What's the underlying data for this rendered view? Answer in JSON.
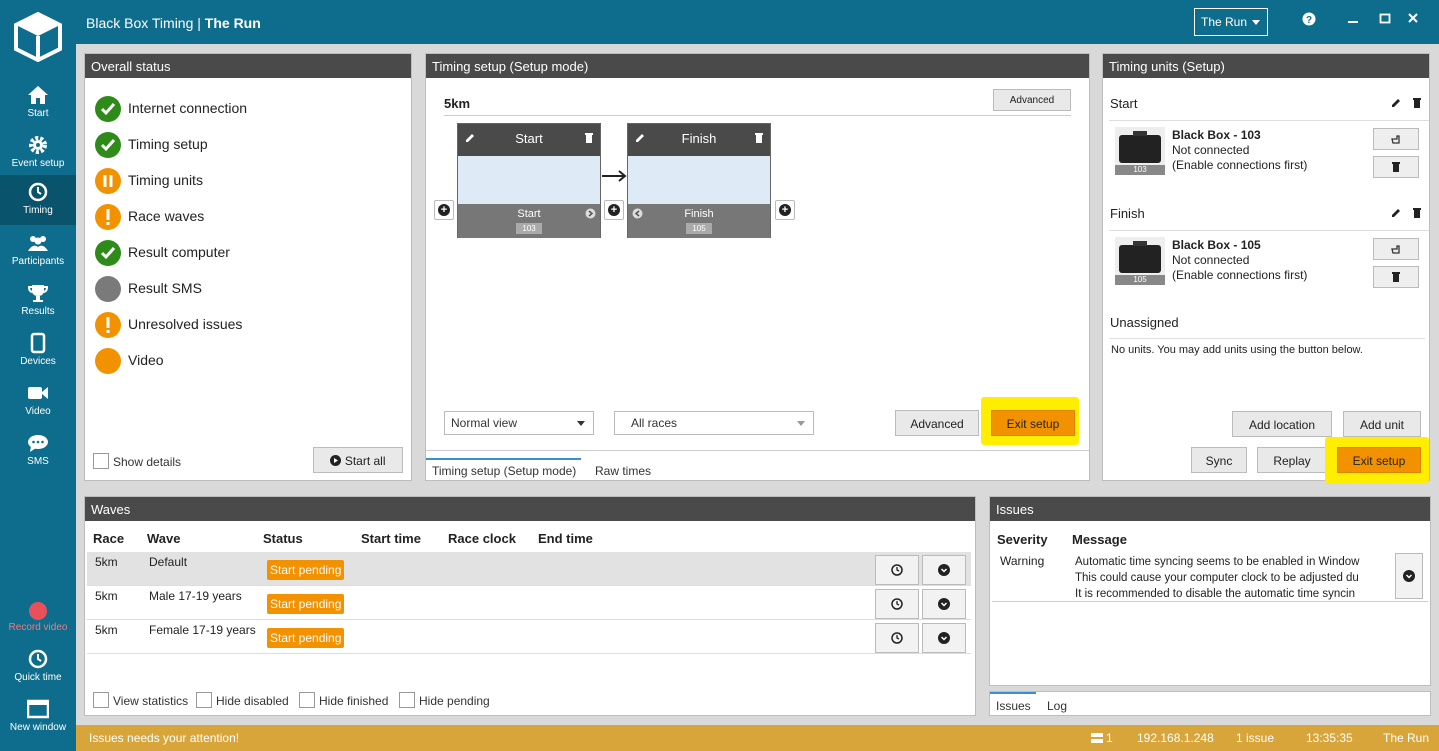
{
  "sidebar": {
    "items": [
      {
        "label": "Start",
        "icon": "home-icon"
      },
      {
        "label": "Event setup",
        "icon": "gear-icon"
      },
      {
        "label": "Timing",
        "icon": "clock-icon"
      },
      {
        "label": "Participants",
        "icon": "people-icon"
      },
      {
        "label": "Results",
        "icon": "trophy-icon"
      },
      {
        "label": "Devices",
        "icon": "tablet-icon"
      },
      {
        "label": "Video",
        "icon": "camera-icon"
      },
      {
        "label": "SMS",
        "icon": "chat-icon"
      }
    ],
    "bottom": [
      {
        "label": "Record video",
        "icon": "record-icon"
      },
      {
        "label": "Quick time",
        "icon": "clock-icon"
      },
      {
        "label": "New window",
        "icon": "window-icon"
      }
    ]
  },
  "title": {
    "app": "Black Box Timing |",
    "event": "The Run",
    "selector": "The Run"
  },
  "colors": {
    "accent": "#0e6d8d",
    "orange": "#f39200",
    "green": "#2e8b1a",
    "gray": "#7a7a7a",
    "highlight": "#ffee00"
  },
  "overall": {
    "title": "Overall status",
    "items": [
      {
        "label": "Internet connection",
        "state": "ok"
      },
      {
        "label": "Timing setup",
        "state": "ok"
      },
      {
        "label": "Timing units",
        "state": "pause"
      },
      {
        "label": "Race waves",
        "state": "warn"
      },
      {
        "label": "Result computer",
        "state": "ok"
      },
      {
        "label": "Result SMS",
        "state": "off"
      },
      {
        "label": "Unresolved issues",
        "state": "warn"
      },
      {
        "label": "Video",
        "state": "pending"
      }
    ],
    "show_details": "Show details",
    "start_all": "Start all"
  },
  "timing": {
    "title": "Timing setup (Setup mode)",
    "race": "5km",
    "advanced_small": "Advanced",
    "nodes": [
      {
        "title": "Start",
        "footer": "Start",
        "unit": "103"
      },
      {
        "title": "Finish",
        "footer": "Finish",
        "unit": "105"
      }
    ],
    "view_select": "Normal view",
    "race_select": "All races",
    "advanced": "Advanced",
    "exit_setup": "Exit setup",
    "tabs": [
      "Timing setup (Setup mode)",
      "Raw times"
    ]
  },
  "units": {
    "title": "Timing units (Setup)",
    "groups": [
      {
        "label": "Start",
        "name": "Black Box - 103",
        "status": "Not connected",
        "note": "(Enable connections first)",
        "badge": "103"
      },
      {
        "label": "Finish",
        "name": "Black Box - 105",
        "status": "Not connected",
        "note": "(Enable connections first)",
        "badge": "105"
      }
    ],
    "unassigned": "Unassigned",
    "no_units": "No units. You may add units using the button below.",
    "add_location": "Add location",
    "add_unit": "Add unit",
    "sync": "Sync",
    "replay": "Replay",
    "exit_setup": "Exit setup"
  },
  "waves": {
    "title": "Waves",
    "columns": [
      "Race",
      "Wave",
      "Status",
      "Start time",
      "Race clock",
      "End time"
    ],
    "rows": [
      {
        "race": "5km",
        "wave": "Default",
        "status": "Start pending"
      },
      {
        "race": "5km",
        "wave": "Male 17-19 years",
        "status": "Start pending"
      },
      {
        "race": "5km",
        "wave": "Female 17-19 years",
        "status": "Start pending"
      }
    ],
    "filters": [
      "View statistics",
      "Hide disabled",
      "Hide finished",
      "Hide pending"
    ]
  },
  "issues": {
    "title": "Issues",
    "columns": [
      "Severity",
      "Message"
    ],
    "rows": [
      {
        "severity": "Warning",
        "lines": [
          "Automatic time syncing seems to be enabled in Window",
          "This could cause your computer clock to be adjusted du",
          "It is recommended to disable the automatic time syncin"
        ]
      }
    ],
    "tabs": [
      "Issues",
      "Log"
    ]
  },
  "status": {
    "message": "Issues needs your attention!",
    "count": "1",
    "ip": "192.168.1.248",
    "issues": "1 issue",
    "time": "13:35:35",
    "event": "The Run"
  }
}
